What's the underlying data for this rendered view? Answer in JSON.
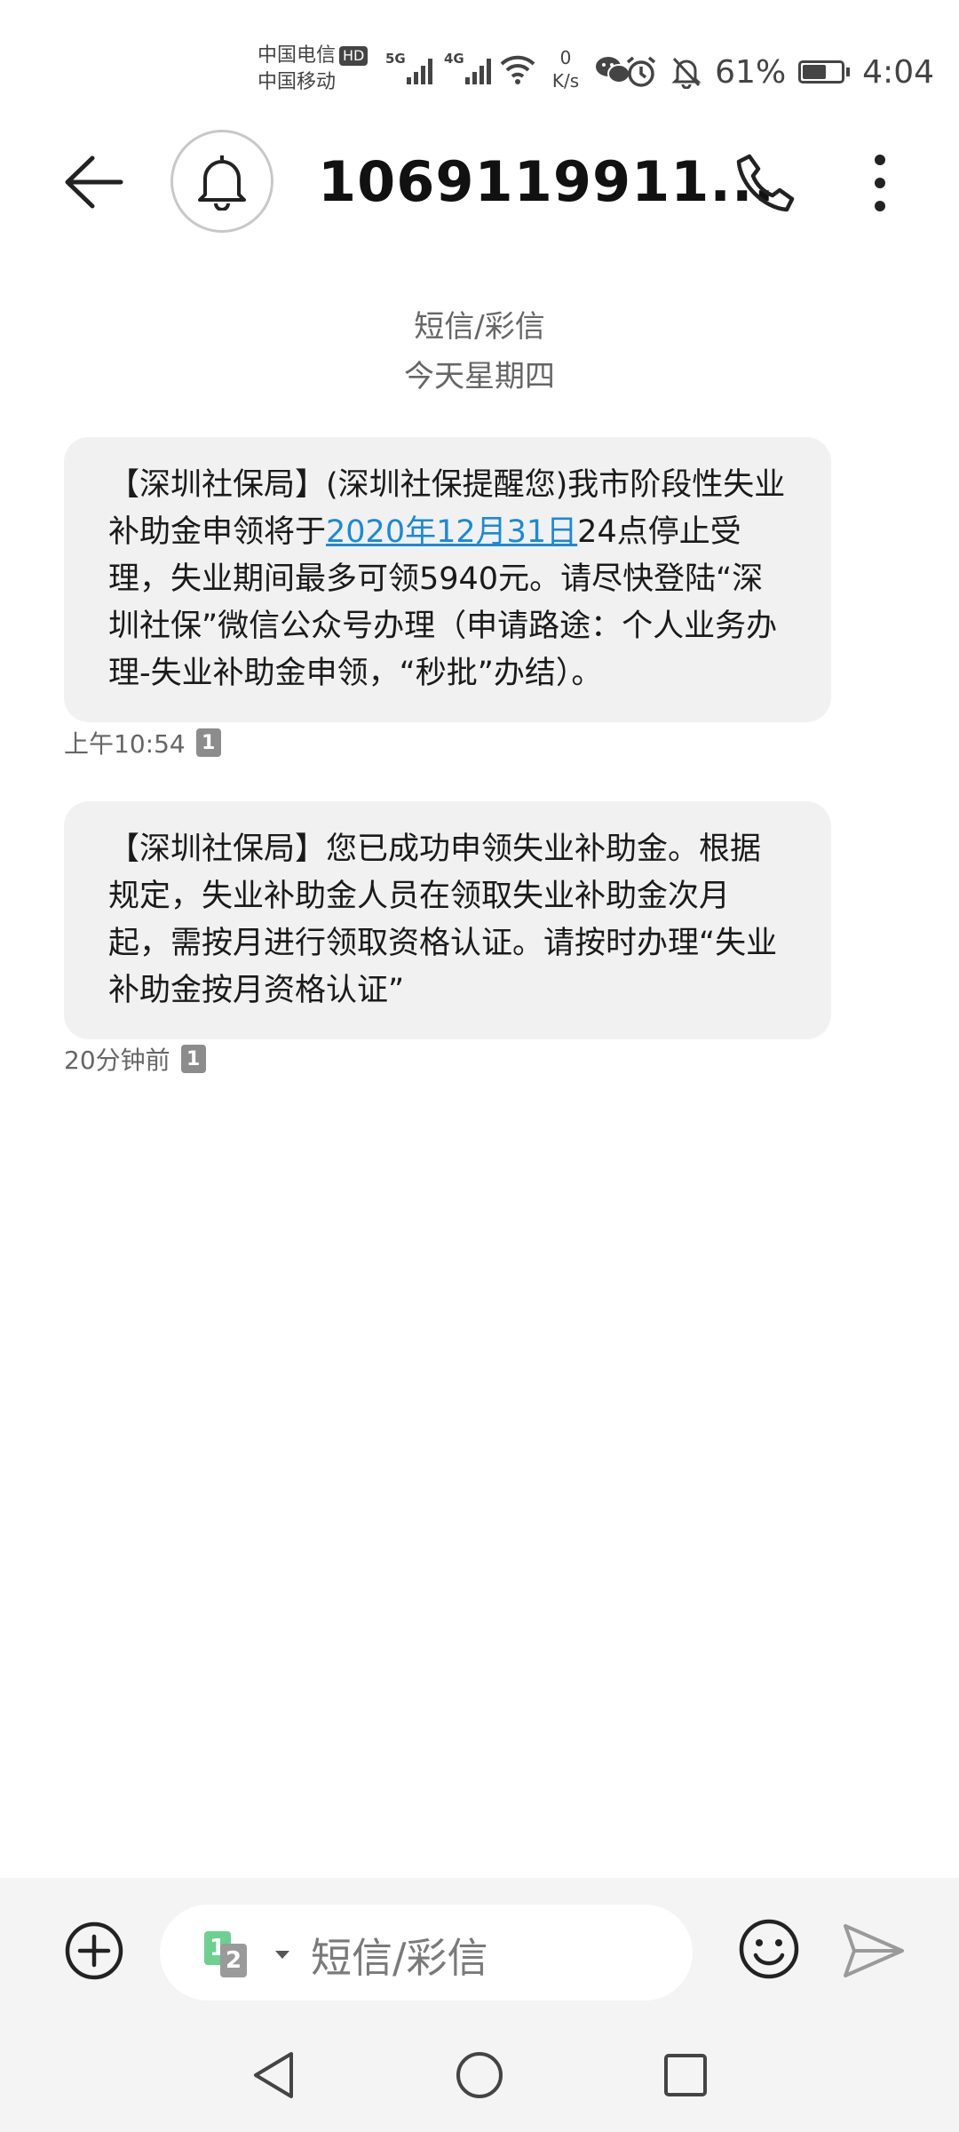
{
  "status_bar": {
    "carrier_1": "中国电信",
    "carrier_1_badge": "HD",
    "carrier_2": "中国移动",
    "sig1_label": "5G",
    "sig2_label": "4G",
    "net_speed_value": "0",
    "net_speed_unit": "K/s",
    "battery_percent": "61%",
    "battery_level": 0.61,
    "time": "4:04"
  },
  "header": {
    "contact": "1069119911..."
  },
  "conversation": {
    "type_label": "短信/彩信",
    "day_label": "今天星期四",
    "messages": [
      {
        "text_before_link": "【深圳社保局】(深圳社保提醒您)我市阶段性失业补助金申领将于",
        "link_text": "2020年12月31日",
        "text_after_link": "24点停止受理，失业期间最多可领5940元。请尽快登陆“深圳社保”微信公众号办理（申请路途：个人业务办理-失业补助金申领，“秒批”办结）。",
        "time": "上午10:54",
        "sim": "1"
      },
      {
        "text": "【深圳社保局】您已成功申领失业补助金。根据规定，失业补助金人员在领取失业补助金次月起，需按月进行领取资格认证。请按时办理“失业补助金按月资格认证”",
        "time": "20分钟前",
        "sim": "1"
      }
    ]
  },
  "input_bar": {
    "sim_primary": "1",
    "sim_secondary": "2",
    "placeholder": "短信/彩信"
  },
  "colors": {
    "accent_link": "#1a8ad6",
    "bubble_bg": "#f1f1f1",
    "sim1_green": "#6cd08f"
  }
}
